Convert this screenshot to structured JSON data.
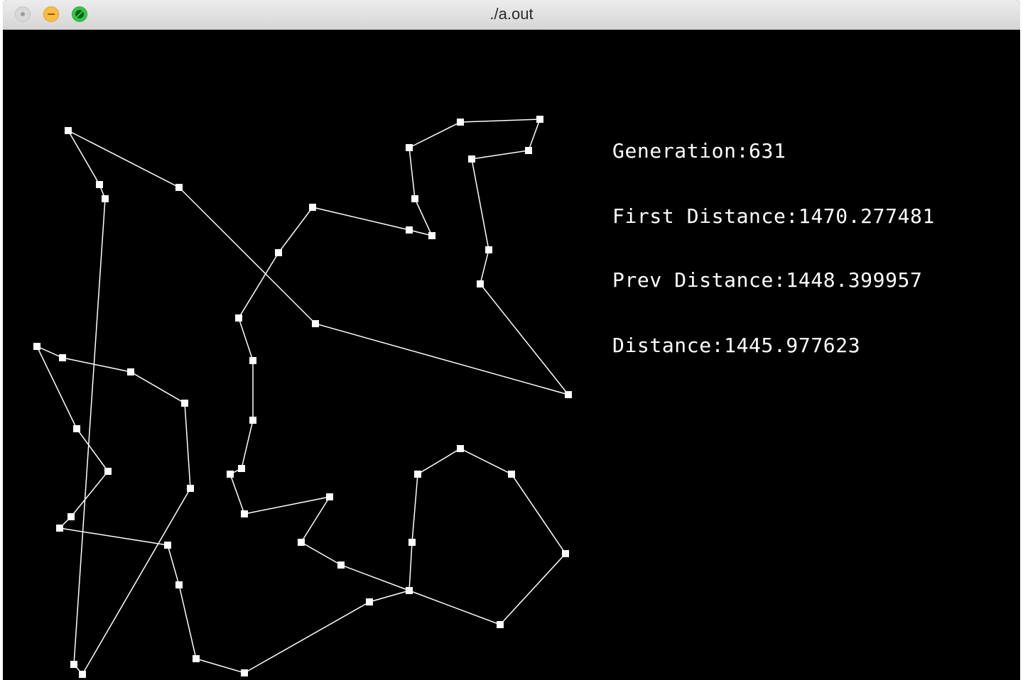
{
  "window": {
    "title": "./a.out"
  },
  "hud": {
    "generation_label": "Generation:",
    "generation": "631",
    "first_distance_label": "First Distance:",
    "first_distance": "1470.277481",
    "prev_distance_label": "Prev Distance:",
    "prev_distance": "1448.399957",
    "distance_label": "Distance:",
    "distance": "1445.977623"
  },
  "colors": {
    "background": "#000000",
    "path": "#ffffff",
    "text": "#ffffff"
  }
}
